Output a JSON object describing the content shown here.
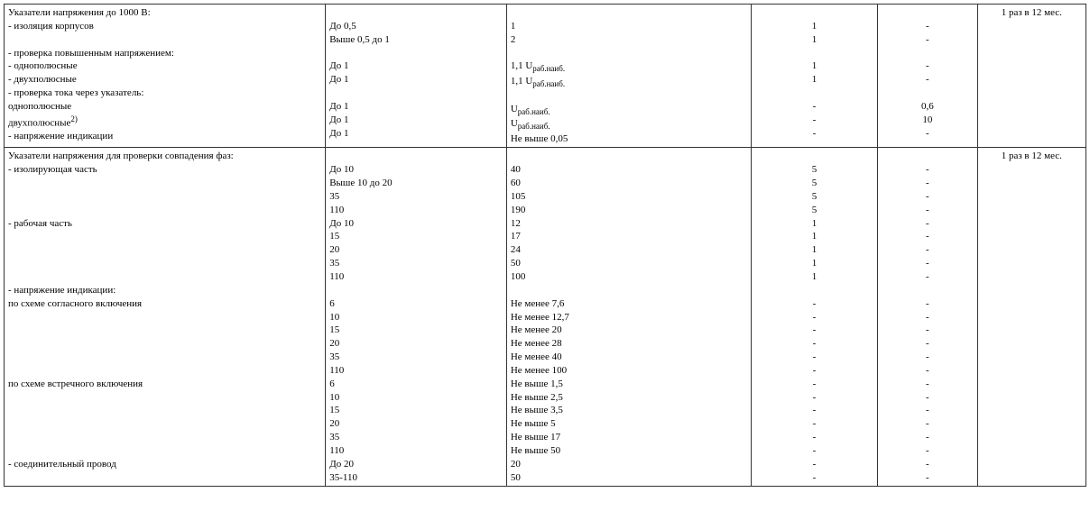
{
  "rows": [
    {
      "c1": [
        "Указатели напряжения до 1000 В:",
        "- изоляция корпусов",
        "",
        "- проверка повышенным напряжением:",
        "- однополюсные",
        "- двухполюсные",
        "- проверка тока через указатель:",
        "однополюсные",
        "двухполюсные{SUP2)}",
        "- напряжение индикации"
      ],
      "c2": [
        "",
        "До 0,5",
        "Выше 0,5 до 1",
        "",
        "До 1",
        "До 1",
        "",
        "До 1",
        "До 1",
        "До 1"
      ],
      "c3": [
        "",
        "1",
        "2",
        "",
        "1,1 U{SUBраб.наиб.}",
        "1,1 U{SUBраб.наиб.}",
        "",
        "U{SUBраб.наиб.}",
        "U{SUBраб.наиб.}",
        "Не выше 0,05"
      ],
      "c4": [
        "",
        "1",
        "1",
        "",
        "1",
        "1",
        "",
        "-",
        "-",
        "-"
      ],
      "c5": [
        "",
        "-",
        "-",
        "",
        "-",
        "-",
        "",
        "0,6",
        "10",
        "-"
      ],
      "c6": [
        "1 раз в 12 мес."
      ]
    },
    {
      "c1": [
        "Указатели напряжения для проверки совпадения фаз:",
        "- изолирующая часть",
        "",
        "",
        "",
        "- рабочая часть",
        "",
        "",
        "",
        "",
        "- напряжение индикации:",
        "по схеме согласного включения",
        "",
        "",
        "",
        "",
        "",
        "по схеме встречного включения",
        "",
        "",
        "",
        "",
        "",
        "- соединительный провод",
        ""
      ],
      "c2": [
        "",
        "До 10",
        "Выше 10 до 20",
        "35",
        "110",
        "До 10",
        "15",
        "20",
        "35",
        "110",
        "",
        "6",
        "10",
        "15",
        "20",
        "35",
        "110",
        "6",
        "10",
        "15",
        "20",
        "35",
        "110",
        "До 20",
        "35-110"
      ],
      "c3": [
        "",
        "40",
        "60",
        "105",
        "190",
        "12",
        "17",
        "24",
        "50",
        "100",
        "",
        "Не менее 7,6",
        "Не менее 12,7",
        "Не менее 20",
        "Не менее 28",
        "Не менее 40",
        "Не менее 100",
        "Не выше 1,5",
        "Не выше 2,5",
        "Не выше 3,5",
        "Не выше 5",
        "Не выше 17",
        "Не выше 50",
        "20",
        "50"
      ],
      "c4": [
        "",
        "5",
        "5",
        "5",
        "5",
        "1",
        "1",
        "1",
        "1",
        "1",
        "",
        "-",
        "-",
        "-",
        "-",
        "-",
        "-",
        "-",
        "-",
        "-",
        "-",
        "-",
        "-",
        "-",
        "-"
      ],
      "c5": [
        "",
        "-",
        "-",
        "-",
        "-",
        "-",
        "-",
        "-",
        "-",
        "-",
        "",
        "-",
        "-",
        "-",
        "-",
        "-",
        "-",
        "-",
        "-",
        "-",
        "-",
        "-",
        "-",
        "-",
        "-"
      ],
      "c6": [
        "1 раз в 12 мес."
      ]
    }
  ]
}
